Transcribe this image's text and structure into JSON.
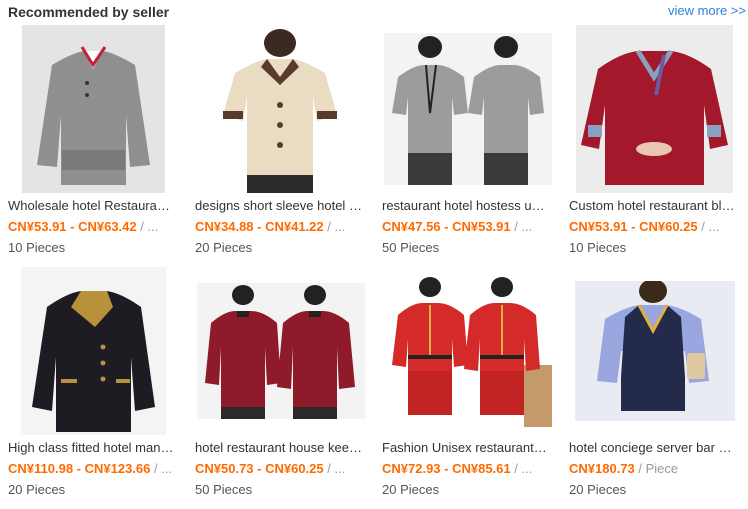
{
  "section": {
    "title": "Recommended by seller",
    "view_more": "view more >>"
  },
  "products": [
    {
      "title": "Wholesale hotel Restaurant long sleeve uniform",
      "price": "CN¥53.91 - CN¥63.42",
      "unit": " / ...",
      "moq": "10 Pieces"
    },
    {
      "title": "designs short sleeve hotel housekeeping uniform",
      "price": "CN¥34.88 - CN¥41.22",
      "unit": " / ...",
      "moq": "20 Pieces"
    },
    {
      "title": "restaurant hotel hostess uniform",
      "price": "CN¥47.56 - CN¥53.91",
      "unit": " / ...",
      "moq": "50 Pieces"
    },
    {
      "title": "Custom hotel restaurant blouse uniform",
      "price": "CN¥53.91 - CN¥60.25",
      "unit": " / ...",
      "moq": "10 Pieces"
    },
    {
      "title": "High class fitted hotel manager uniform",
      "price": "CN¥110.98 - CN¥123.66",
      "unit": " / ...",
      "moq": "20 Pieces"
    },
    {
      "title": "hotel restaurant house keeping uniform",
      "price": "CN¥50.73 - CN¥60.25",
      "unit": " / ...",
      "moq": "50 Pieces"
    },
    {
      "title": "Fashion Unisex restaurant waiter uniform",
      "price": "CN¥72.93 - CN¥85.61",
      "unit": " / ...",
      "moq": "20 Pieces"
    },
    {
      "title": "hotel conciege server bar uniform",
      "price": "CN¥180.73",
      "unit": " / Piece",
      "moq": "20 Pieces"
    }
  ],
  "colors": {
    "price": "#ff6a00",
    "link": "#2f7fd7"
  }
}
